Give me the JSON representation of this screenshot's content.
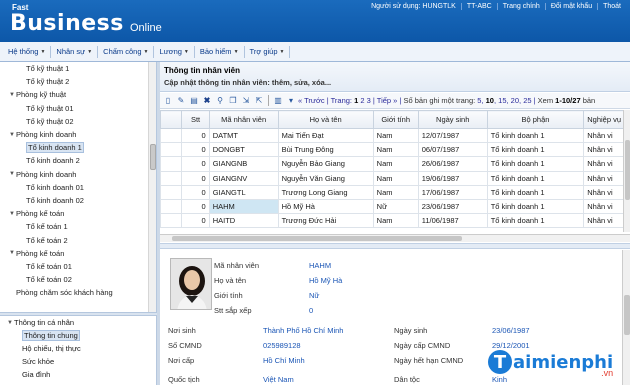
{
  "header": {
    "logo_small": "Fast",
    "logo_main": "Business",
    "logo_suffix": "Online",
    "user": "Người sử dụng: HUNGTLK",
    "company": "TT-ABC",
    "links": [
      "Trang chính",
      "Đổi mật khẩu",
      "Thoát"
    ]
  },
  "menu": [
    "Hệ thống",
    "Nhân sự",
    "Chấm công",
    "Lương",
    "Bảo hiểm",
    "Trợ giúp"
  ],
  "tree": [
    {
      "label": "Tổ kỹ thuật 1",
      "level": 2,
      "toggle": ""
    },
    {
      "label": "Tổ kỹ thuật 2",
      "level": 2,
      "toggle": ""
    },
    {
      "label": "Phòng kỹ thuật",
      "level": 1,
      "toggle": "▼"
    },
    {
      "label": "Tổ kỹ thuật 01",
      "level": 2,
      "toggle": ""
    },
    {
      "label": "Tổ kỹ thuật 02",
      "level": 2,
      "toggle": ""
    },
    {
      "label": "Phòng kinh doanh",
      "level": 1,
      "toggle": "▼"
    },
    {
      "label": "Tổ kinh doanh 1",
      "level": 2,
      "toggle": "",
      "selected": true
    },
    {
      "label": "Tổ kinh doanh 2",
      "level": 2,
      "toggle": ""
    },
    {
      "label": "Phòng kinh doanh",
      "level": 1,
      "toggle": "▼"
    },
    {
      "label": "Tổ kinh doanh 01",
      "level": 2,
      "toggle": ""
    },
    {
      "label": "Tổ kinh doanh 02",
      "level": 2,
      "toggle": ""
    },
    {
      "label": "Phòng kế toán",
      "level": 1,
      "toggle": "▼"
    },
    {
      "label": "Tổ kế toán 1",
      "level": 2,
      "toggle": ""
    },
    {
      "label": "Tổ kế toán 2",
      "level": 2,
      "toggle": ""
    },
    {
      "label": "Phòng kế toán",
      "level": 1,
      "toggle": "▼"
    },
    {
      "label": "Tổ kế toán 01",
      "level": 2,
      "toggle": ""
    },
    {
      "label": "Tổ kế toán 02",
      "level": 2,
      "toggle": ""
    },
    {
      "label": "Phòng chăm sóc khách hàng",
      "level": 1,
      "toggle": ""
    }
  ],
  "sidebar2": {
    "section": "Thông tin cá nhân",
    "items": [
      "Thông tin chung",
      "Hộ chiếu, thị thực",
      "Sức khỏe",
      "Gia đình"
    ]
  },
  "panel": {
    "title": "Thông tin nhân viên",
    "subtitle": "Cập nhật thông tin nhân viên: thêm, sửa, xóa..."
  },
  "pager": {
    "prev": "« Trước",
    "page_label": "Trang:",
    "pages": [
      "1",
      "2",
      "3"
    ],
    "next": "Tiếp »",
    "per_page_label": "Số bản ghi một trang:",
    "per_page_options": [
      "5",
      "10",
      "15",
      "20",
      "25"
    ],
    "per_page_selected": "10",
    "range_label": "Xem",
    "range": "1-10/27",
    "trailing": "bản"
  },
  "grid": {
    "columns": [
      "Stt",
      "Mã nhân viên",
      "Họ và tên",
      "Giới tính",
      "Ngày sinh",
      "Bộ phận",
      "Nghiệp vụ"
    ],
    "rows": [
      [
        "0",
        "DATMT",
        "Mai Tiến Đạt",
        "Nam",
        "12/07/1987",
        "Tổ kinh doanh 1",
        "Nhân vi"
      ],
      [
        "0",
        "DONGBT",
        "Bùi Trung Đông",
        "Nam",
        "06/07/1987",
        "Tổ kinh doanh 1",
        "Nhân vi"
      ],
      [
        "0",
        "GIANGNB",
        "Nguyễn Bảo Giang",
        "Nam",
        "26/06/1987",
        "Tổ kinh doanh 1",
        "Nhân vi"
      ],
      [
        "0",
        "GIANGNV",
        "Nguyễn Văn Giang",
        "Nam",
        "19/06/1987",
        "Tổ kinh doanh 1",
        "Nhân vi"
      ],
      [
        "0",
        "GIANGTL",
        "Trương Long Giang",
        "Nam",
        "17/06/1987",
        "Tổ kinh doanh 1",
        "Nhân vi"
      ],
      [
        "0",
        "HAHM",
        "Hồ Mỹ Hà",
        "Nữ",
        "23/06/1987",
        "Tổ kinh doanh 1",
        "Nhân vi"
      ],
      [
        "0",
        "HAITD",
        "Trương Đức Hải",
        "Nam",
        "11/06/1987",
        "Tổ kinh doanh 1",
        "Nhân vi"
      ]
    ],
    "selected_index": 5
  },
  "detail": {
    "top": [
      {
        "label": "Mã nhân viên",
        "value": "HAHM"
      },
      {
        "label": "Họ và tên",
        "value": "Hồ Mỹ Hà"
      },
      {
        "label": "Giới tính",
        "value": "Nữ"
      },
      {
        "label": "Stt sắp xếp",
        "value": "0"
      }
    ],
    "left": [
      {
        "label": "Nơi sinh",
        "value": "Thành Phố Hồ Chí Minh"
      },
      {
        "label": "Số CMND",
        "value": "025989128"
      },
      {
        "label": "Nơi cấp",
        "value": "Hồ Chí Minh"
      },
      {
        "label": "Quốc tịch",
        "value": "Việt Nam"
      }
    ],
    "right": [
      {
        "label": "Ngày sinh",
        "value": "23/06/1987"
      },
      {
        "label": "Ngày cấp CMND",
        "value": "29/12/2001"
      },
      {
        "label": "Ngày hết hạn CMND",
        "value": ""
      },
      {
        "label": "Dân tộc",
        "value": "Kinh"
      }
    ]
  },
  "watermark": {
    "main": "aimienphi",
    "tld": ".vn"
  },
  "colors": {
    "header": "#1565b8",
    "link": "#1a55b5",
    "selection": "#cfe6f3"
  }
}
